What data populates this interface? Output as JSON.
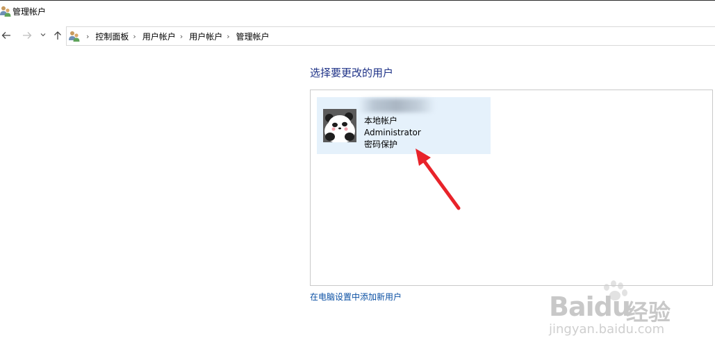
{
  "window": {
    "title": "管理帐户"
  },
  "navigation": {
    "back_icon": "back-arrow-icon",
    "forward_icon": "forward-arrow-icon",
    "recent_icon": "chevron-down-icon",
    "up_icon": "up-arrow-icon"
  },
  "address": {
    "icon": "users-icon",
    "crumbs": [
      "控制面板",
      "用户帐户",
      "用户帐户",
      "管理帐户"
    ]
  },
  "main": {
    "heading": "选择要更改的用户",
    "user_tile": {
      "account_type": "本地帐户",
      "role": "Administrator",
      "password_status": "密码保护"
    },
    "add_user_link": "在电脑设置中添加新用户"
  },
  "watermark": {
    "brand": "Baidu",
    "brand_cn": "经验",
    "url": "jingyan.baidu.com"
  },
  "colors": {
    "heading": "#1e3287",
    "link": "#0a4fa3",
    "tile_bg": "#e5f1fb",
    "annotation_arrow": "#e8232a"
  }
}
